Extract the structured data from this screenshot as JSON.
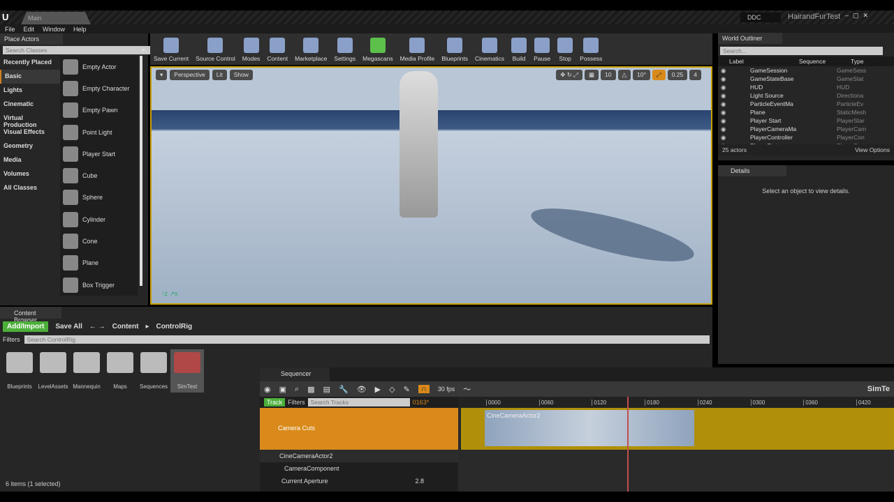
{
  "window": {
    "tab": "Main",
    "project": "HairandFurTest",
    "ddc": "DDC"
  },
  "menu": [
    "File",
    "Edit",
    "Window",
    "Help"
  ],
  "place_actors": {
    "title": "Place Actors",
    "search_placeholder": "Search Classes",
    "categories": [
      "Recently Placed",
      "Basic",
      "Lights",
      "Cinematic",
      "Virtual Production",
      "Visual Effects",
      "Geometry",
      "Media",
      "Volumes",
      "All Classes"
    ],
    "selected_category": "Basic",
    "items": [
      "Empty Actor",
      "Empty Character",
      "Empty Pawn",
      "Point Light",
      "Player Start",
      "Cube",
      "Sphere",
      "Cylinder",
      "Cone",
      "Plane",
      "Box Trigger"
    ]
  },
  "toolbar": [
    "Save Current",
    "Source Control",
    "Modes",
    "Content",
    "Marketplace",
    "Settings",
    "Megascans",
    "Media Profile",
    "Blueprints",
    "Cinematics",
    "Build",
    "Pause",
    "Stop",
    "Possess"
  ],
  "viewport": {
    "perspective": "Perspective",
    "lit": "Lit",
    "show": "Show",
    "grid": "10",
    "rotation": "10°",
    "scale": "0.25",
    "camera_speed": "4"
  },
  "outliner": {
    "title": "World Outliner",
    "search_placeholder": "Search...",
    "columns": [
      "Label",
      "Sequence",
      "Type"
    ],
    "rows": [
      [
        "GameSession",
        "GameSess"
      ],
      [
        "GameStateBase",
        "GameStat"
      ],
      [
        "HUD",
        "HUD"
      ],
      [
        "Light Source",
        "Directiona"
      ],
      [
        "ParticleEventMa",
        "ParticleEv"
      ],
      [
        "Plane",
        "StaticMesh"
      ],
      [
        "Player Start",
        "PlayerStar"
      ],
      [
        "PlayerCameraMa",
        "PlayerCam"
      ],
      [
        "PlayerController",
        "PlayerCon"
      ],
      [
        "PlayerState",
        "PlayerStat"
      ]
    ],
    "count": "25 actors",
    "view_options": "View Options"
  },
  "details": {
    "title": "Details",
    "empty": "Select an object to view details."
  },
  "content_browser": {
    "title": "Content Browser",
    "add_import": "Add/Import",
    "save_all": "Save All",
    "path": [
      "Content",
      "ControlRig"
    ],
    "filters": "Filters",
    "search_placeholder": "Search ControlRig",
    "assets": [
      "Blueprints",
      "LevelAssets",
      "Mannequin",
      "Maps",
      "Sequences",
      "SimTest"
    ],
    "selected": "SimTest",
    "status": "6 items (1 selected)"
  },
  "sequencer": {
    "title": "Sequencer",
    "track": "Track",
    "filters": "Filters",
    "search_placeholder": "Search Tracks",
    "current_frame": "0163*",
    "fps": "30 fps",
    "sequence_name": "SimTe",
    "ticks": [
      "0000",
      "0060",
      "0120",
      "0180",
      "0240",
      "0300",
      "0360",
      "0420"
    ],
    "tracks": [
      {
        "label": "Camera Cuts"
      },
      {
        "label": "CineCameraActor2"
      },
      {
        "label": "CameraComponent"
      },
      {
        "label": "Current Aperture",
        "value": "2.8"
      }
    ],
    "clip_label": "CineCameraActor2"
  },
  "colors": {
    "accent": "#d98a1a",
    "selection": "#c9a000",
    "add_green": "#4caf3a"
  }
}
